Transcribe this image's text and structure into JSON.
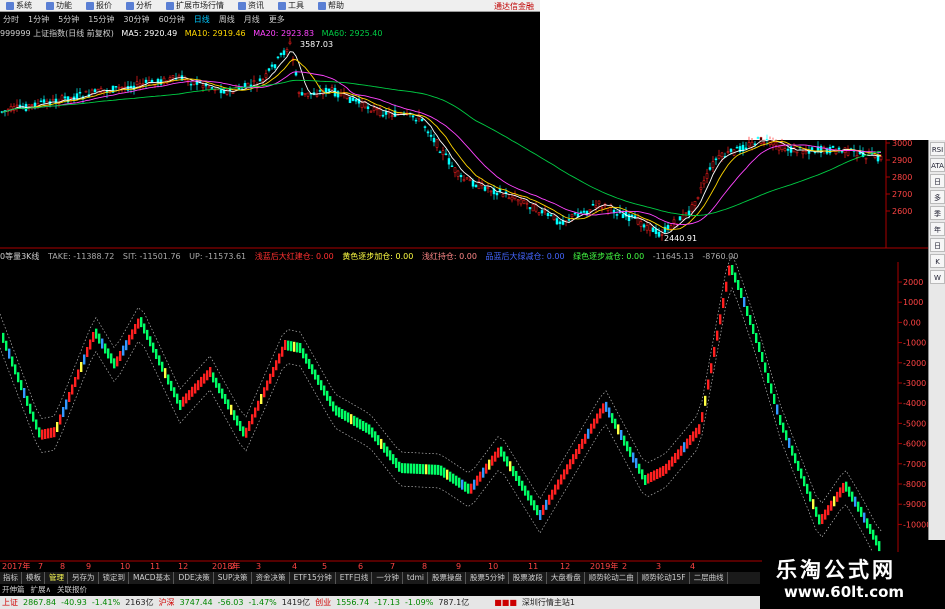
{
  "menu": {
    "items": [
      "系统",
      "功能",
      "报价",
      "分析",
      "扩展市场行情",
      "资讯",
      "工具",
      "帮助"
    ],
    "brand": "通达信金融"
  },
  "periods": {
    "items": [
      "分时",
      "1分钟",
      "5分钟",
      "15分钟",
      "30分钟",
      "60分钟",
      "日线",
      "周线",
      "月线",
      "更多"
    ],
    "active": "日线"
  },
  "upper_info": {
    "title": "999999 上证指数(日线 前复权)",
    "ma5": "MA5: 2920.49",
    "ma10": "MA10: 2919.46",
    "ma20": "MA20: 2923.83",
    "ma60": "MA60: 2925.40"
  },
  "upper_chart": {
    "high_label": "3587.03",
    "low_label": "2440.91",
    "y_ticks": [
      "3000",
      "2900",
      "2800",
      "2700",
      "2600"
    ]
  },
  "lower_info": {
    "title": "0等量3K线",
    "take": "TAKE: -11388.72",
    "sit": "SIT: -11501.76",
    "up": "UP: -11573.61",
    "i1": "浅蓝后大红建仓: 0.00",
    "i2": "黄色逐步加仓: 0.00",
    "i3": "浅红持仓: 0.00",
    "i4": "品蓝后大绿减仓: 0.00",
    "i5": "绿色逐步减仓: 0.00",
    "v1": "-11645.13",
    "v2": "-8760.00"
  },
  "lower_chart": {
    "y_ticks": [
      "2000",
      "1000",
      "0.00",
      "-1000",
      "-2000",
      "-3000",
      "-4000",
      "-5000",
      "-6000",
      "-7000",
      "-8000",
      "-9000",
      "-10000"
    ],
    "x_labels": [
      "2017年",
      "7",
      "8",
      "9",
      "10",
      "11",
      "12",
      "2018年",
      "2",
      "3",
      "4",
      "5",
      "6",
      "7",
      "8",
      "9",
      "10",
      "11",
      "12",
      "2019年",
      "2",
      "3",
      "4"
    ]
  },
  "sidebar_tools": [
    "RSI",
    "ATA",
    "日",
    "多",
    "季",
    "年",
    "日",
    "K",
    "W"
  ],
  "tabs": {
    "items": [
      "指标",
      "模板",
      "管理",
      "另存为",
      "锁定到",
      "MACD基本",
      "DDE决策",
      "SUP决策",
      "资金决策",
      "ETF15分钟",
      "ETF日线",
      "一分钟",
      "tdmi",
      "股票操盘",
      "股票5分钟",
      "股票波段",
      "大盘看盘",
      "顺势轮动二曲",
      "顺势轮动15F",
      "二层曲线"
    ],
    "selected": "管理",
    "row2": [
      "开伸篇",
      "扩展∧",
      "关联报价"
    ]
  },
  "status": {
    "sh_label": "上证",
    "sh_value": "2867.84",
    "sh_change": "-40.93",
    "sh_pct": "-1.41%",
    "sh_amount": "2163亿",
    "hs_label": "沪深",
    "hs_value": "3747.44",
    "hs_change": "-56.03",
    "hs_pct": "-1.47%",
    "hs_amount": "1419亿",
    "cy_label": "创业",
    "cy_value": "1556.74",
    "cy_change": "-17.13",
    "cy_pct": "-1.09%",
    "cy_amount": "787.1亿",
    "site": "深圳行情主站1"
  },
  "watermark": {
    "title": "乐淘公式网",
    "url": "www.60lt.com"
  },
  "colors": {
    "up_candle": "#ff2020",
    "down_candle": "#00ff66",
    "blue_candle": "#3399ff",
    "yellow_candle": "#ffff44",
    "ma5": "#ffffff",
    "ma10": "#ffd700",
    "ma20": "#ff44ff",
    "ma60": "#00cc44",
    "axis": "#aa0000"
  }
}
